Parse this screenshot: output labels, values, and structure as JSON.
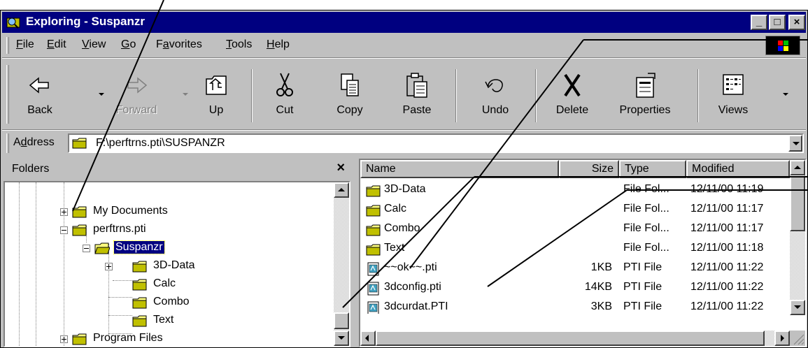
{
  "window": {
    "title": "Exploring - Suspanzr"
  },
  "title_buttons": [
    {
      "name": "minimize-button",
      "glyph": "_"
    },
    {
      "name": "maximize-button",
      "glyph": "□"
    },
    {
      "name": "close-button",
      "glyph": "×"
    }
  ],
  "menu": [
    {
      "key": "F",
      "rest": "ile"
    },
    {
      "key": "E",
      "rest": "dit"
    },
    {
      "key": "V",
      "rest": "iew"
    },
    {
      "key": "G",
      "rest": "o"
    },
    {
      "pre": "F",
      "key": "a",
      "rest": "vorites"
    },
    {
      "key": "T",
      "rest": "ools"
    },
    {
      "key": "H",
      "rest": "elp"
    }
  ],
  "toolbar": {
    "back": "Back",
    "forward": "Forward",
    "up": "Up",
    "cut": "Cut",
    "copy": "Copy",
    "paste": "Paste",
    "undo": "Undo",
    "delete": "Delete",
    "properties": "Properties",
    "views": "Views"
  },
  "address": {
    "pre": "A",
    "key": "d",
    "rest": "dress",
    "path": "F:\\perftrns.pti\\SUSPANZR"
  },
  "folders": {
    "title": "Folders",
    "close_glyph": "×",
    "tree": [
      {
        "label": "My Documents",
        "toggle": "plus",
        "selected": false,
        "open": false
      },
      {
        "label": "perftrns.pti",
        "toggle": "minus",
        "selected": false,
        "open": false
      },
      {
        "label": "Suspanzr",
        "toggle": "minus",
        "selected": true,
        "open": true
      },
      {
        "label": "3D-Data",
        "toggle": "plus",
        "selected": false,
        "open": false
      },
      {
        "label": "Calc",
        "toggle": "",
        "selected": false,
        "open": false
      },
      {
        "label": "Combo",
        "toggle": "",
        "selected": false,
        "open": false
      },
      {
        "label": "Text",
        "toggle": "",
        "selected": false,
        "open": false
      },
      {
        "label": "Program Files",
        "toggle": "plus",
        "selected": false,
        "open": false
      }
    ]
  },
  "files": {
    "columns": {
      "name": "Name",
      "size": "Size",
      "type": "Type",
      "modified": "Modified"
    },
    "rows": [
      {
        "name": "3D-Data",
        "size": "",
        "type": "File Fol...",
        "modified": "12/11/00 11:19",
        "icon": "folder-icon"
      },
      {
        "name": "Calc",
        "size": "",
        "type": "File Fol...",
        "modified": "12/11/00 11:17",
        "icon": "folder-icon"
      },
      {
        "name": "Combo",
        "size": "",
        "type": "File Fol...",
        "modified": "12/11/00 11:17",
        "icon": "folder-icon"
      },
      {
        "name": "Text",
        "size": "",
        "type": "File Fol...",
        "modified": "12/11/00 11:18",
        "icon": "folder-icon"
      },
      {
        "name": "~~ok~~.pti",
        "size": "1KB",
        "type": "PTI File",
        "modified": "12/11/00 11:22",
        "icon": "pti-file-icon"
      },
      {
        "name": "3dconfig.pti",
        "size": "14KB",
        "type": "PTI File",
        "modified": "12/11/00 11:22",
        "icon": "pti-file-icon"
      },
      {
        "name": "3dcurdat.PTI",
        "size": "3KB",
        "type": "PTI File",
        "modified": "12/11/00 11:22",
        "icon": "pti-file-icon"
      }
    ]
  },
  "colors": {
    "titlebar": "#000080",
    "face": "#c0c0c0",
    "selection": "#000080"
  }
}
